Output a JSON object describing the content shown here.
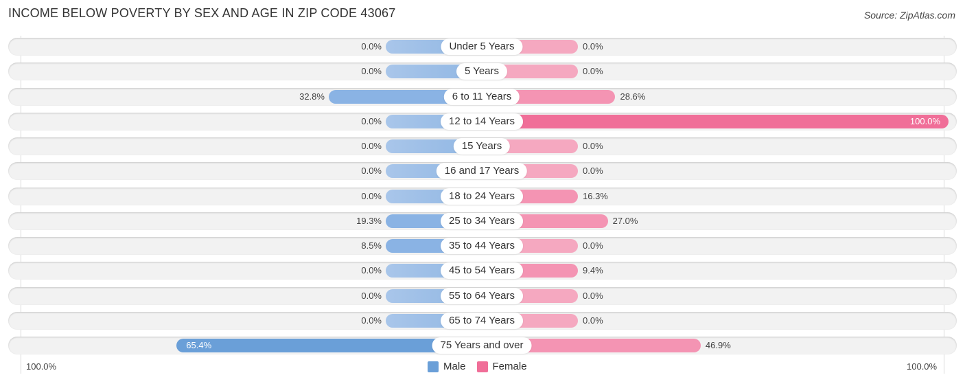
{
  "header": {
    "title": "INCOME BELOW POVERTY BY SEX AND AGE IN ZIP CODE 43067",
    "source": "Source: ZipAtlas.com"
  },
  "colors": {
    "male": "#6a9fd8",
    "male_light": "#a9c6ea",
    "female": "#f06e98",
    "female_light": "#f5a8c0"
  },
  "chart_data": {
    "type": "bar",
    "orientation": "horizontal-diverging",
    "title": "INCOME BELOW POVERTY BY SEX AND AGE IN ZIP CODE 43067",
    "categories": [
      "Under 5 Years",
      "5 Years",
      "6 to 11 Years",
      "12 to 14 Years",
      "15 Years",
      "16 and 17 Years",
      "18 to 24 Years",
      "25 to 34 Years",
      "35 to 44 Years",
      "45 to 54 Years",
      "55 to 64 Years",
      "65 to 74 Years",
      "75 Years and over"
    ],
    "series": [
      {
        "name": "Male",
        "values": [
          0.0,
          0.0,
          32.8,
          0.0,
          0.0,
          0.0,
          0.0,
          19.3,
          8.5,
          0.0,
          0.0,
          0.0,
          65.4
        ],
        "labels": [
          "0.0%",
          "0.0%",
          "32.8%",
          "0.0%",
          "0.0%",
          "0.0%",
          "0.0%",
          "19.3%",
          "8.5%",
          "0.0%",
          "0.0%",
          "0.0%",
          "65.4%"
        ]
      },
      {
        "name": "Female",
        "values": [
          0.0,
          0.0,
          28.6,
          100.0,
          0.0,
          0.0,
          16.3,
          27.0,
          0.0,
          9.4,
          0.0,
          0.0,
          46.9
        ],
        "labels": [
          "0.0%",
          "0.0%",
          "28.6%",
          "100.0%",
          "0.0%",
          "0.0%",
          "16.3%",
          "27.0%",
          "0.0%",
          "9.4%",
          "0.0%",
          "0.0%",
          "46.9%"
        ]
      }
    ],
    "xlim": [
      -100,
      100
    ],
    "axis_labels": {
      "left": "100.0%",
      "right": "100.0%"
    },
    "legend": {
      "position": "bottom-center",
      "entries": [
        "Male",
        "Female"
      ]
    },
    "grid": false
  }
}
